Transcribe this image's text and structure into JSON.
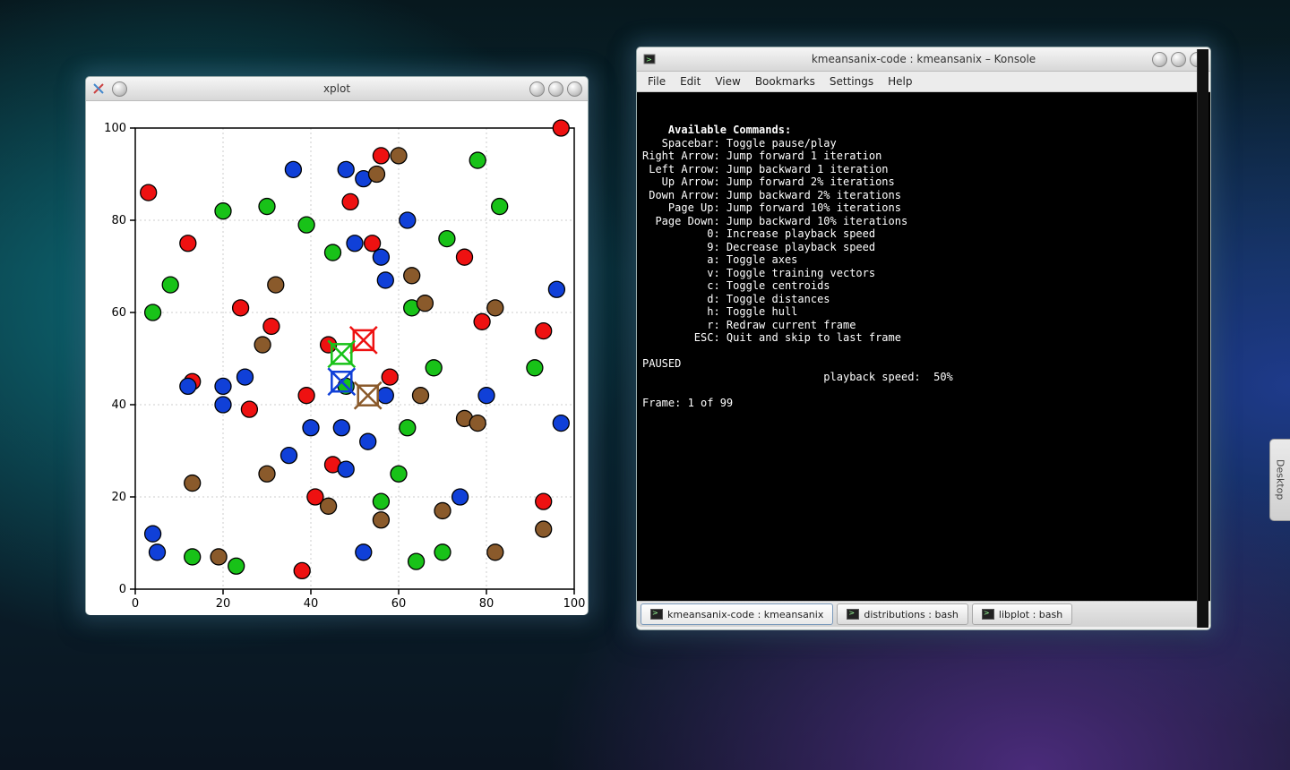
{
  "xplot": {
    "title": "xplot",
    "axis": {
      "ticks_x": [
        0,
        20,
        40,
        60,
        80,
        100
      ],
      "ticks_y": [
        0,
        20,
        40,
        60,
        80,
        100
      ]
    }
  },
  "konsole": {
    "title": "kmeansanix-code : kmeansanix – Konsole",
    "menu": {
      "file": "File",
      "edit": "Edit",
      "view": "View",
      "bookmarks": "Bookmarks",
      "settings": "Settings",
      "help": "Help"
    },
    "tabs": [
      {
        "label": "kmeansanix-code : kmeansanix",
        "active": true
      },
      {
        "label": "distributions : bash",
        "active": false
      },
      {
        "label": "libplot : bash",
        "active": false
      }
    ],
    "term": {
      "heading": "Available Commands:",
      "lines": [
        "   Spacebar: Toggle pause/play",
        "Right Arrow: Jump forward 1 iteration",
        " Left Arrow: Jump backward 1 iteration",
        "   Up Arrow: Jump forward 2% iterations",
        " Down Arrow: Jump backward 2% iterations",
        "    Page Up: Jump forward 10% iterations",
        "  Page Down: Jump backward 10% iterations",
        "          0: Increase playback speed",
        "          9: Decrease playback speed",
        "          a: Toggle axes",
        "          v: Toggle training vectors",
        "          c: Toggle centroids",
        "          d: Toggle distances",
        "          h: Toggle hull",
        "          r: Redraw current frame",
        "        ESC: Quit and skip to last frame",
        "",
        "PAUSED",
        "                            playback speed:  50%",
        "",
        "Frame: 1 of 99"
      ]
    }
  },
  "desktop_tab": "Desktop",
  "chart_data": {
    "type": "scatter",
    "title": "",
    "xlabel": "",
    "ylabel": "",
    "xlim": [
      0,
      100
    ],
    "ylim": [
      0,
      100
    ],
    "x_ticks": [
      0,
      20,
      40,
      60,
      80,
      100
    ],
    "y_ticks": [
      0,
      20,
      40,
      60,
      80,
      100
    ],
    "colors": {
      "red": "#e11",
      "green": "#18c218",
      "blue": "#1040d8",
      "brown": "#8a5a2b"
    },
    "centroids": [
      {
        "cluster": "red",
        "x": 52,
        "y": 54
      },
      {
        "cluster": "green",
        "x": 47,
        "y": 51
      },
      {
        "cluster": "blue",
        "x": 47,
        "y": 45
      },
      {
        "cluster": "brown",
        "x": 53,
        "y": 42
      }
    ],
    "points": [
      {
        "c": "red",
        "x": 3,
        "y": 86
      },
      {
        "c": "red",
        "x": 12,
        "y": 75
      },
      {
        "c": "red",
        "x": 97,
        "y": 100
      },
      {
        "c": "red",
        "x": 56,
        "y": 94
      },
      {
        "c": "red",
        "x": 49,
        "y": 84
      },
      {
        "c": "red",
        "x": 54,
        "y": 75
      },
      {
        "c": "red",
        "x": 75,
        "y": 72
      },
      {
        "c": "red",
        "x": 93,
        "y": 56
      },
      {
        "c": "red",
        "x": 24,
        "y": 61
      },
      {
        "c": "red",
        "x": 31,
        "y": 57
      },
      {
        "c": "red",
        "x": 44,
        "y": 53
      },
      {
        "c": "red",
        "x": 58,
        "y": 46
      },
      {
        "c": "red",
        "x": 39,
        "y": 42
      },
      {
        "c": "red",
        "x": 45,
        "y": 27
      },
      {
        "c": "red",
        "x": 93,
        "y": 19
      },
      {
        "c": "red",
        "x": 38,
        "y": 4
      },
      {
        "c": "red",
        "x": 79,
        "y": 58
      },
      {
        "c": "red",
        "x": 13,
        "y": 45
      },
      {
        "c": "red",
        "x": 26,
        "y": 39
      },
      {
        "c": "red",
        "x": 41,
        "y": 20
      },
      {
        "c": "green",
        "x": 20,
        "y": 82
      },
      {
        "c": "green",
        "x": 30,
        "y": 83
      },
      {
        "c": "green",
        "x": 83,
        "y": 83
      },
      {
        "c": "green",
        "x": 8,
        "y": 66
      },
      {
        "c": "green",
        "x": 4,
        "y": 60
      },
      {
        "c": "green",
        "x": 39,
        "y": 79
      },
      {
        "c": "green",
        "x": 45,
        "y": 73
      },
      {
        "c": "green",
        "x": 71,
        "y": 76
      },
      {
        "c": "green",
        "x": 78,
        "y": 93
      },
      {
        "c": "green",
        "x": 68,
        "y": 48
      },
      {
        "c": "green",
        "x": 62,
        "y": 35
      },
      {
        "c": "green",
        "x": 56,
        "y": 19
      },
      {
        "c": "green",
        "x": 64,
        "y": 6
      },
      {
        "c": "green",
        "x": 70,
        "y": 8
      },
      {
        "c": "green",
        "x": 13,
        "y": 7
      },
      {
        "c": "green",
        "x": 23,
        "y": 5
      },
      {
        "c": "green",
        "x": 48,
        "y": 44
      },
      {
        "c": "green",
        "x": 63,
        "y": 61
      },
      {
        "c": "green",
        "x": 91,
        "y": 48
      },
      {
        "c": "green",
        "x": 60,
        "y": 25
      },
      {
        "c": "blue",
        "x": 4,
        "y": 12
      },
      {
        "c": "blue",
        "x": 5,
        "y": 8
      },
      {
        "c": "blue",
        "x": 12,
        "y": 44
      },
      {
        "c": "blue",
        "x": 20,
        "y": 40
      },
      {
        "c": "blue",
        "x": 25,
        "y": 46
      },
      {
        "c": "blue",
        "x": 36,
        "y": 91
      },
      {
        "c": "blue",
        "x": 48,
        "y": 91
      },
      {
        "c": "blue",
        "x": 52,
        "y": 89
      },
      {
        "c": "blue",
        "x": 50,
        "y": 75
      },
      {
        "c": "blue",
        "x": 56,
        "y": 72
      },
      {
        "c": "blue",
        "x": 62,
        "y": 80
      },
      {
        "c": "blue",
        "x": 96,
        "y": 65
      },
      {
        "c": "blue",
        "x": 97,
        "y": 36
      },
      {
        "c": "blue",
        "x": 80,
        "y": 42
      },
      {
        "c": "blue",
        "x": 57,
        "y": 42
      },
      {
        "c": "blue",
        "x": 53,
        "y": 32
      },
      {
        "c": "blue",
        "x": 40,
        "y": 35
      },
      {
        "c": "blue",
        "x": 35,
        "y": 29
      },
      {
        "c": "blue",
        "x": 48,
        "y": 26
      },
      {
        "c": "blue",
        "x": 52,
        "y": 8
      },
      {
        "c": "blue",
        "x": 74,
        "y": 20
      },
      {
        "c": "blue",
        "x": 57,
        "y": 67
      },
      {
        "c": "blue",
        "x": 47,
        "y": 35
      },
      {
        "c": "blue",
        "x": 20,
        "y": 44
      },
      {
        "c": "brown",
        "x": 19,
        "y": 7
      },
      {
        "c": "brown",
        "x": 13,
        "y": 23
      },
      {
        "c": "brown",
        "x": 30,
        "y": 25
      },
      {
        "c": "brown",
        "x": 56,
        "y": 15
      },
      {
        "c": "brown",
        "x": 70,
        "y": 17
      },
      {
        "c": "brown",
        "x": 82,
        "y": 8
      },
      {
        "c": "brown",
        "x": 32,
        "y": 66
      },
      {
        "c": "brown",
        "x": 29,
        "y": 53
      },
      {
        "c": "brown",
        "x": 63,
        "y": 68
      },
      {
        "c": "brown",
        "x": 66,
        "y": 62
      },
      {
        "c": "brown",
        "x": 82,
        "y": 61
      },
      {
        "c": "brown",
        "x": 75,
        "y": 37
      },
      {
        "c": "brown",
        "x": 78,
        "y": 36
      },
      {
        "c": "brown",
        "x": 55,
        "y": 90
      },
      {
        "c": "brown",
        "x": 60,
        "y": 94
      },
      {
        "c": "brown",
        "x": 65,
        "y": 42
      },
      {
        "c": "brown",
        "x": 44,
        "y": 18
      },
      {
        "c": "brown",
        "x": 93,
        "y": 13
      }
    ]
  }
}
